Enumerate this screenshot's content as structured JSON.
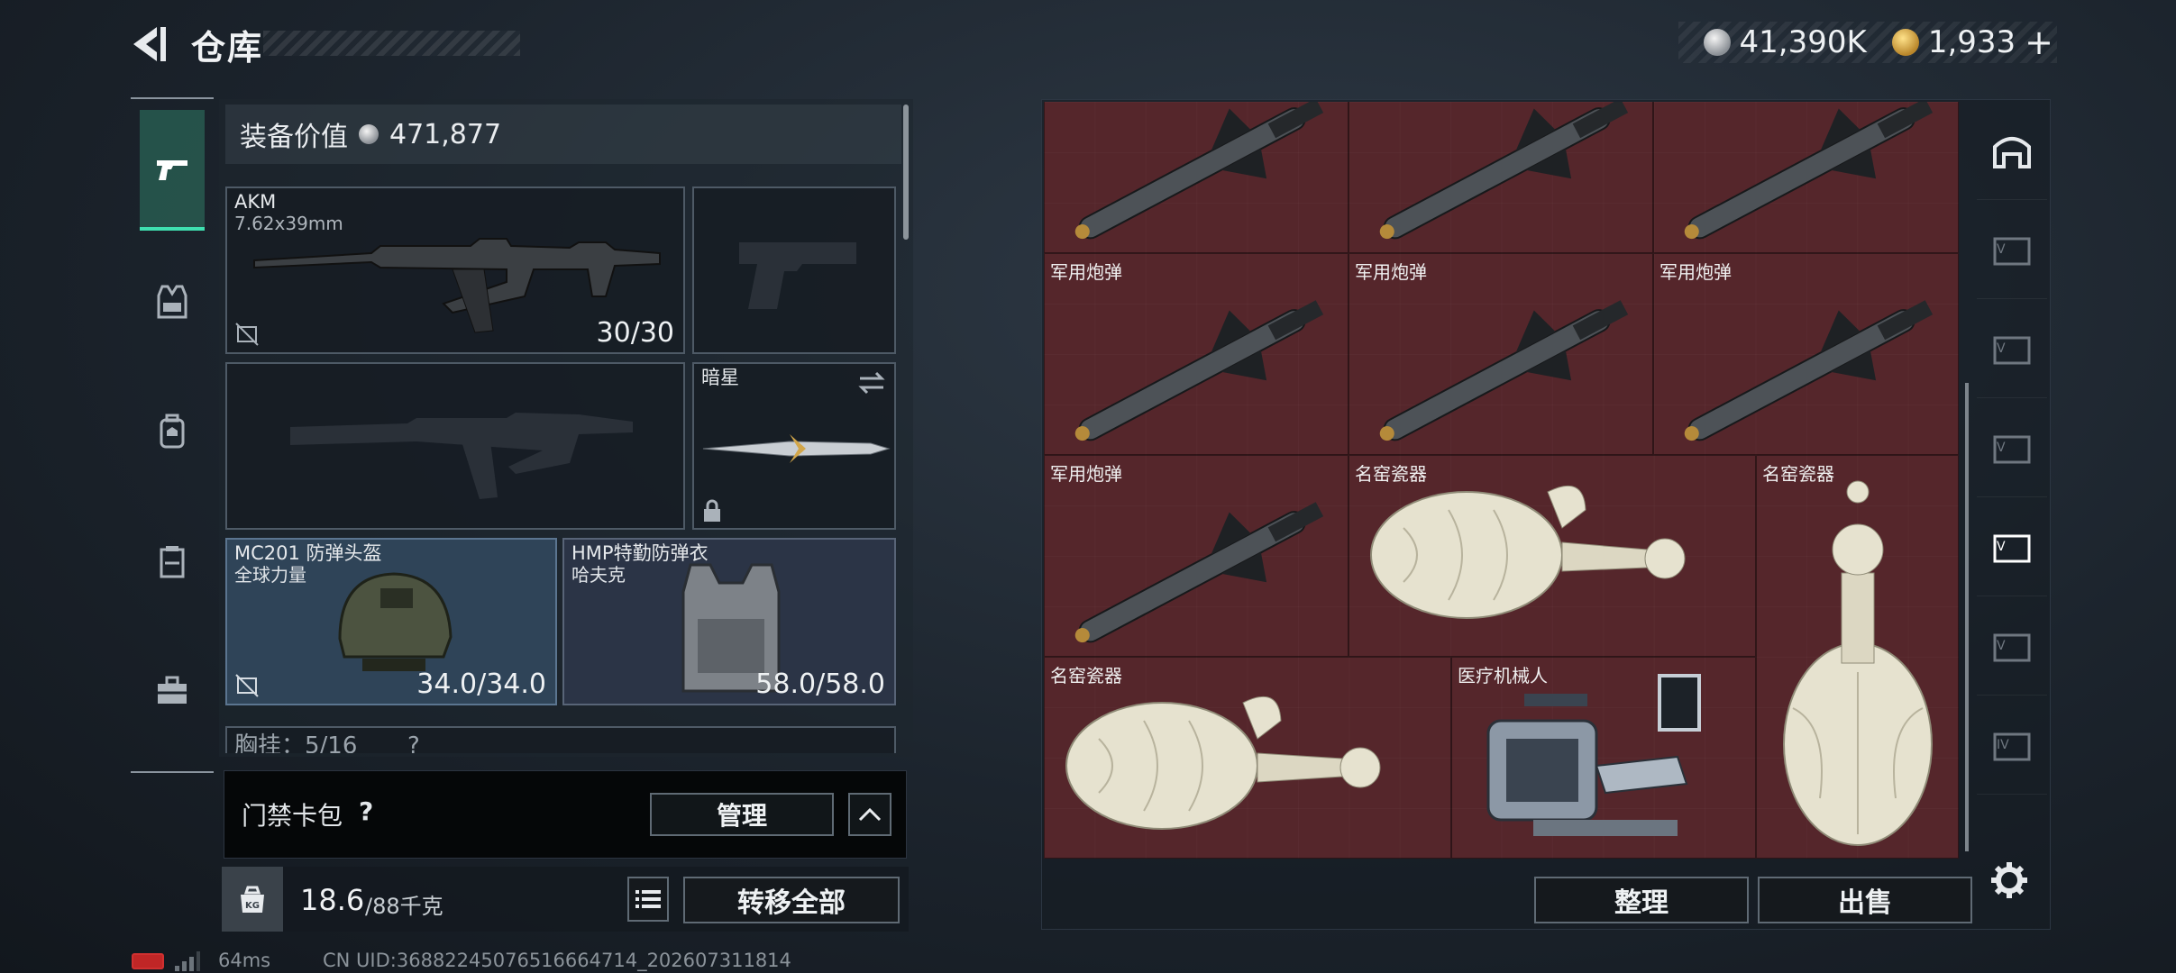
{
  "header": {
    "title": "仓库",
    "currency_silver": "41,390K",
    "currency_gold": "1,933",
    "plus": "+"
  },
  "equipment": {
    "value_label": "装备价值",
    "value": "471,877",
    "slots": {
      "primary": {
        "name": "AKM",
        "sub": "7.62x39mm",
        "value": "30/30"
      },
      "melee": {
        "name": "暗星"
      },
      "helmet": {
        "name": "MC201 防弹头盔",
        "sub": "全球力量",
        "value": "34.0/34.0"
      },
      "armor": {
        "name": "HMP特勤防弹衣",
        "sub": "哈夫克",
        "value": "58.0/58.0"
      },
      "rig": {
        "name": "胸挂：5/16",
        "help": "?"
      }
    }
  },
  "access_card": {
    "label": "门禁卡包",
    "help": "?",
    "manage": "管理"
  },
  "weight": {
    "current": "18.6",
    "max": "/88千克",
    "transfer_all": "转移全部"
  },
  "storage": {
    "items": [
      {
        "label": ""
      },
      {
        "label": ""
      },
      {
        "label": ""
      },
      {
        "label": "军用炮弹"
      },
      {
        "label": "军用炮弹"
      },
      {
        "label": "军用炮弹"
      },
      {
        "label": "军用炮弹"
      },
      {
        "label": "名窑瓷器"
      },
      {
        "label": "名窑瓷器"
      },
      {
        "label": "名窑瓷器"
      },
      {
        "label": "医疗机械人"
      }
    ],
    "sort": "整理",
    "sell": "出售"
  },
  "footer": {
    "ping": "64ms",
    "uid": "CN UID:3688224507651666471​4_202607311814"
  },
  "colors": {
    "accent": "#3fe0b0",
    "grid_bg": "#4a2428"
  }
}
